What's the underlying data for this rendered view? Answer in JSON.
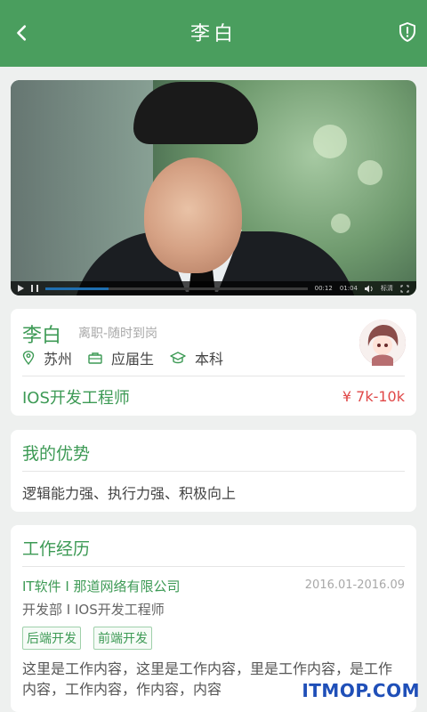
{
  "header": {
    "title": "李白"
  },
  "video": {
    "time_current": "00:12",
    "time_total": "01:04",
    "quality_label": "标清",
    "progress": 0.24
  },
  "profile": {
    "name": "李白",
    "status": "离职-随时到岗",
    "location": "苏州",
    "experience": "应届生",
    "education": "本科",
    "job_title": "IOS开发工程师",
    "salary": "¥ 7k-10k"
  },
  "advantage": {
    "title": "我的优势",
    "text": "逻辑能力强、执行力强、积极向上"
  },
  "work": {
    "title": "工作经历",
    "company_line": "IT软件  I  那道网络有限公司",
    "period": "2016.01-2016.09",
    "dept_line": "开发部  I  IOS开发工程师",
    "tags": [
      "后端开发",
      "前端开发"
    ],
    "content": "这里是工作内容，这里是工作内容，里是工作内容，是工作内容，工作内容，作内容，内容"
  },
  "watermark": "ITMOP.COM",
  "colors": {
    "brand_green": "#4a9e5e",
    "accent_green": "#3d9a55",
    "salary_red": "#e04848"
  }
}
